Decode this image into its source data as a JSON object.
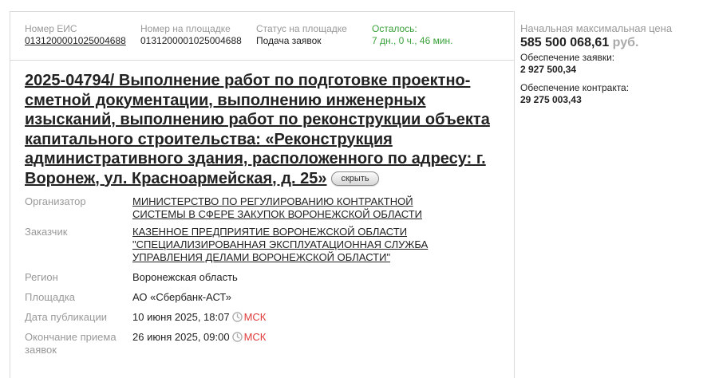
{
  "meta": {
    "eis_label": "Номер ЕИС",
    "eis_value": "0131200001025004688",
    "platform_number_label": "Номер на площадке",
    "platform_number_value": "0131200001025004688",
    "status_label": "Статус на площадке",
    "status_value": "Подача заявок",
    "remaining_label": "Осталось:",
    "remaining_value": "7 дн., 0 ч., 46 мин."
  },
  "title": {
    "line1": "2025-04794/ Выполнение работ по подготовке проектно-",
    "line2": "сметной документации, выполнению инженерных",
    "line3": "изысканий, выполнению работ по реконструкции объекта",
    "line4": "капитального строительства: «Реконструкция",
    "line5": "административного здания, расположенного по адресу: г.",
    "line6": "Воронеж, ул. Красноармейская, д. 25»",
    "hide_label": "скрыть"
  },
  "info": {
    "organizer_label": "Организатор",
    "organizer_line1": "МИНИСТЕРСТВО ПО РЕГУЛИРОВАНИЮ КОНТРАКТНОЙ",
    "organizer_line2": "СИСТЕМЫ В СФЕРЕ ЗАКУПОК ВОРОНЕЖСКОЙ ОБЛАСТИ",
    "customer_label": "Заказчик",
    "customer_line1": "КАЗЕННОЕ ПРЕДПРИЯТИЕ ВОРОНЕЖСКОЙ ОБЛАСТИ",
    "customer_line2": "\"СПЕЦИАЛИЗИРОВАННАЯ ЭКСПЛУАТАЦИОННАЯ СЛУЖБА",
    "customer_line3": "УПРАВЛЕНИЯ ДЕЛАМИ ВОРОНЕЖСКОЙ ОБЛАСТИ\"",
    "region_label": "Регион",
    "region_value": "Воронежская область",
    "platform_label": "Площадка",
    "platform_value": "АО «Сбербанк-АСТ»",
    "published_label": "Дата публикации",
    "published_value": "10 июня 2025, 18:07",
    "deadline_label_line1": "Окончание приема",
    "deadline_label_line2": "заявок",
    "deadline_value": "26 июня 2025, 09:00",
    "tz": "МСК",
    "clock_icon": "clock-icon"
  },
  "side": {
    "price_label": "Начальная максимальная цена",
    "price_value": "585 500 068,61",
    "price_currency": "руб.",
    "bid_security_label": "Обеспечение заявки:",
    "bid_security_value": "2 927 500,34",
    "contract_security_label": "Обеспечение контракта:",
    "contract_security_value": "29 275 003,43"
  },
  "colors": {
    "green": "#3ca23c",
    "red": "#e03c3c",
    "muted": "#999999",
    "border": "#d9d9d9"
  }
}
